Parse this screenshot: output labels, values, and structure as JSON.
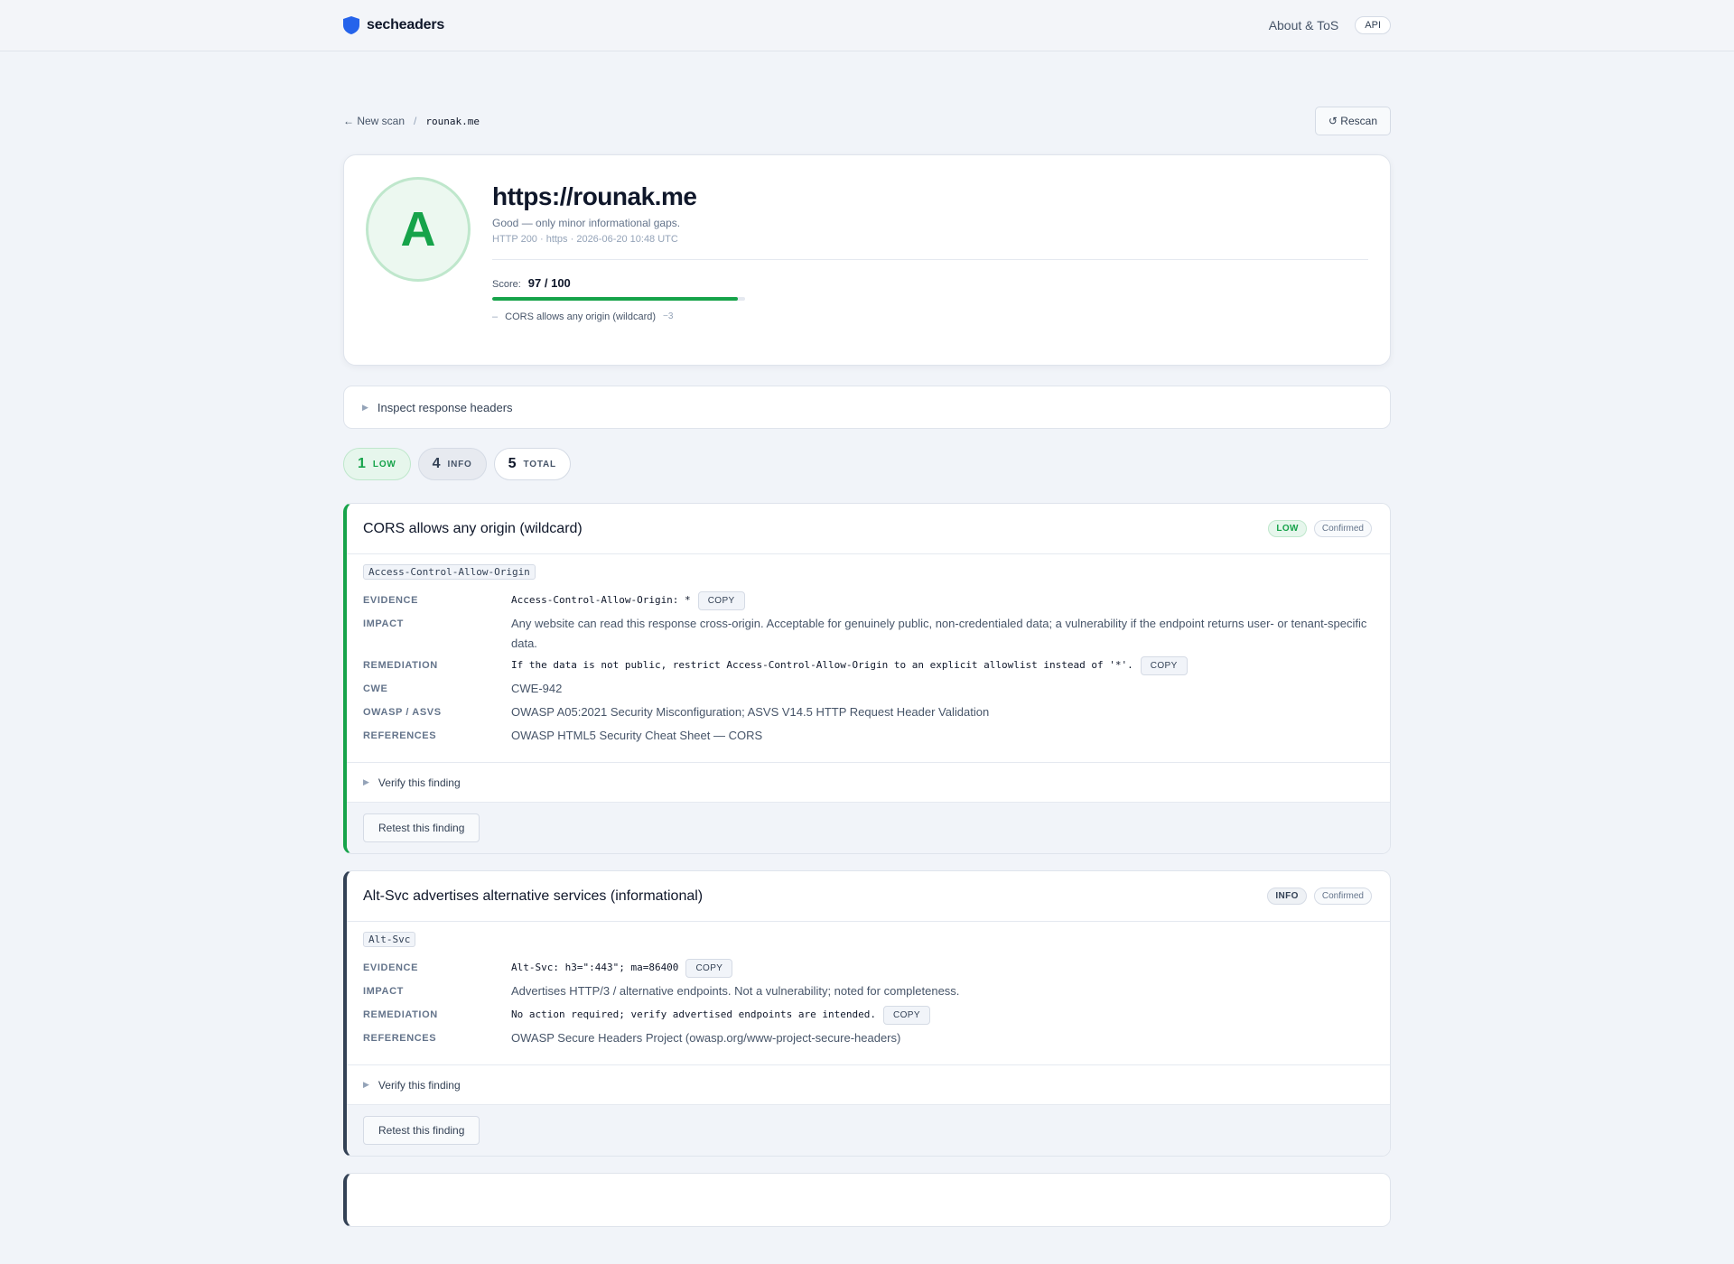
{
  "nav": {
    "brand": "secheaders",
    "about": "About & ToS",
    "api": "API"
  },
  "breadcrumb": {
    "back": "← New scan",
    "separator": "/",
    "host": "rounak.me",
    "rescan": "↺ Rescan"
  },
  "summary": {
    "grade": "A",
    "url": "https://rounak.me",
    "grade_desc": "Good — only minor informational gaps.",
    "meta": "HTTP 200 · https · 2026-06-20 10:48 UTC",
    "score_label": "Score:",
    "score_text": "97 / 100",
    "score_value": 97,
    "score_max": 100,
    "deduction_dash": "–",
    "deduction_text": "CORS allows any origin (wildcard)",
    "deduction_points": "−3"
  },
  "inspect": {
    "label": "Inspect response headers"
  },
  "counters": [
    {
      "num": "1",
      "label": "LOW"
    },
    {
      "num": "4",
      "label": "INFO"
    },
    {
      "num": "5",
      "label": "TOTAL"
    }
  ],
  "findings": [
    {
      "title": "CORS allows any origin (wildcard)",
      "severity": "LOW",
      "status": "Confirmed",
      "header": "Access-Control-Allow-Origin",
      "evidence": "Access-Control-Allow-Origin: *",
      "impact": "Any website can read this response cross-origin. Acceptable for genuinely public, non-credentialed data; a vulnerability if the endpoint returns user- or tenant-specific data.",
      "remediation": "If the data is not public, restrict Access-Control-Allow-Origin to an explicit allowlist instead of '*'.",
      "cwe": "CWE-942",
      "owasp": "OWASP A05:2021 Security Misconfiguration; ASVS V14.5 HTTP Request Header Validation",
      "references": "OWASP HTML5 Security Cheat Sheet — CORS",
      "verify": "Verify this finding",
      "retest": "Retest this finding"
    },
    {
      "title": "Alt-Svc advertises alternative services (informational)",
      "severity": "INFO",
      "status": "Confirmed",
      "header": "Alt-Svc",
      "evidence": "Alt-Svc: h3=\":443\"; ma=86400",
      "impact": "Advertises HTTP/3 / alternative endpoints. Not a vulnerability; noted for completeness.",
      "remediation": "No action required; verify advertised endpoints are intended.",
      "references": "OWASP Secure Headers Project (owasp.org/www-project-secure-headers)",
      "verify": "Verify this finding",
      "retest": "Retest this finding"
    }
  ],
  "labels": {
    "evidence": "EVIDENCE",
    "impact": "IMPACT",
    "remediation": "REMEDIATION",
    "cwe": "CWE",
    "owasp": "OWASP / ASVS",
    "references": "REFERENCES",
    "copy": "COPY"
  },
  "colors": {
    "accent_green": "#16a34a",
    "brand_blue": "#2563eb",
    "info_slate": "#334155"
  }
}
